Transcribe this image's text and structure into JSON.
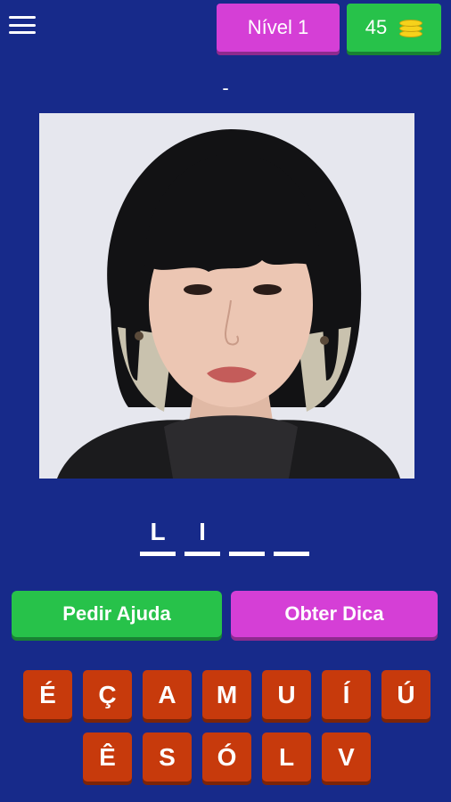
{
  "header": {
    "level_label": "Nível 1",
    "coins": "45",
    "coin_icon": "coins-stack-icon"
  },
  "hint_text": "-",
  "answer": {
    "slots": [
      "L",
      "I",
      "",
      ""
    ]
  },
  "actions": {
    "help_label": "Pedir Ajuda",
    "tip_label": "Obter Dica"
  },
  "keyboard": {
    "row1": [
      "É",
      "Ç",
      "A",
      "M",
      "U",
      "Í",
      "Ú"
    ],
    "row2": [
      "Ê",
      "S",
      "Ó",
      "L",
      "V"
    ]
  },
  "colors": {
    "background": "#172a8a",
    "green": "#27c24a",
    "magenta": "#d53fd6",
    "key": "#c73a0c"
  }
}
